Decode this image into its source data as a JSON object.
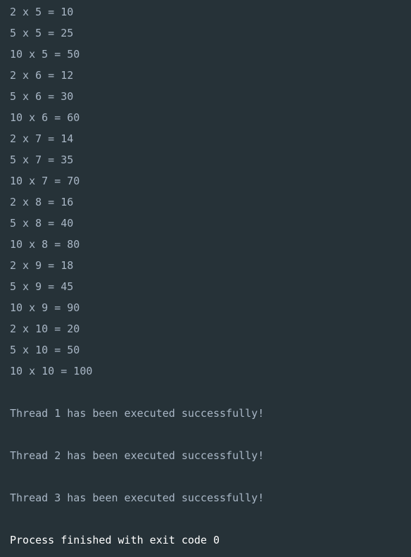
{
  "console": {
    "lines": [
      {
        "text": "2 x 5 = 10",
        "type": "output"
      },
      {
        "text": "5 x 5 = 25",
        "type": "output"
      },
      {
        "text": "10 x 5 = 50",
        "type": "output"
      },
      {
        "text": "2 x 6 = 12",
        "type": "output"
      },
      {
        "text": "5 x 6 = 30",
        "type": "output"
      },
      {
        "text": "10 x 6 = 60",
        "type": "output"
      },
      {
        "text": "2 x 7 = 14",
        "type": "output"
      },
      {
        "text": "5 x 7 = 35",
        "type": "output"
      },
      {
        "text": "10 x 7 = 70",
        "type": "output"
      },
      {
        "text": "2 x 8 = 16",
        "type": "output"
      },
      {
        "text": "5 x 8 = 40",
        "type": "output"
      },
      {
        "text": "10 x 8 = 80",
        "type": "output"
      },
      {
        "text": "2 x 9 = 18",
        "type": "output"
      },
      {
        "text": "5 x 9 = 45",
        "type": "output"
      },
      {
        "text": "10 x 9 = 90",
        "type": "output"
      },
      {
        "text": "2 x 10 = 20",
        "type": "output"
      },
      {
        "text": "5 x 10 = 50",
        "type": "output"
      },
      {
        "text": "10 x 10 = 100",
        "type": "output"
      },
      {
        "text": "",
        "type": "blank"
      },
      {
        "text": "Thread 1 has been executed successfully!",
        "type": "output"
      },
      {
        "text": "",
        "type": "blank"
      },
      {
        "text": "Thread 2 has been executed successfully!",
        "type": "output"
      },
      {
        "text": "",
        "type": "blank"
      },
      {
        "text": "Thread 3 has been executed successfully!",
        "type": "output"
      },
      {
        "text": "",
        "type": "blank"
      },
      {
        "text": "Process finished with exit code 0",
        "type": "final"
      }
    ]
  },
  "colors": {
    "background": "#263238",
    "text": "#a9b7c6",
    "final_text": "#ffffff"
  }
}
